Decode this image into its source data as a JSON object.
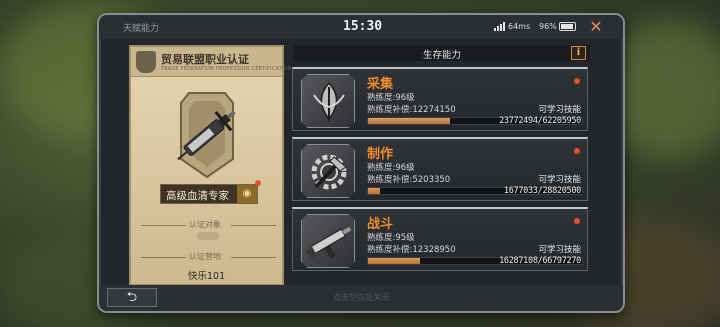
{
  "header": {
    "title": "天赋能力",
    "clock": "15:30",
    "ping": "64ms",
    "battery": "96%",
    "close_icon": "close-icon"
  },
  "certificate": {
    "org_title": "贸易联盟职业认证",
    "org_subtitle": "TRADE FEDERATION PROFESSION CERTIFICATION",
    "cert_name": "高级血清专家",
    "target_label": "认证对象",
    "location_label": "认证营地",
    "location_value": "快乐101"
  },
  "section": {
    "title": "生存能力",
    "info_label": "i"
  },
  "skills": [
    {
      "name": "采集",
      "level": "熟练度:96级",
      "compensation": "熟练度补偿:12274150",
      "learn": "可学习技能",
      "progress_text": "23772494/62205950",
      "progress_fraction": 0.382,
      "icon": "leaf-icon"
    },
    {
      "name": "制作",
      "level": "熟练度:96级",
      "compensation": "熟练度补偿:5203350",
      "learn": "可学习技能",
      "progress_text": "1677033/28820500",
      "progress_fraction": 0.058,
      "icon": "gear-hammer-icon"
    },
    {
      "name": "战斗",
      "level": "熟练度:95级",
      "compensation": "熟练度补偿:12328950",
      "learn": "可学习技能",
      "progress_text": "16287108/66797270",
      "progress_fraction": 0.244,
      "icon": "gun-icon"
    }
  ],
  "footer": {
    "back_label": "⮌",
    "hint": "点击空白处关闭"
  },
  "colors": {
    "accent": "#f08c2c",
    "dot": "#e4512e",
    "progress": "#c98348"
  }
}
